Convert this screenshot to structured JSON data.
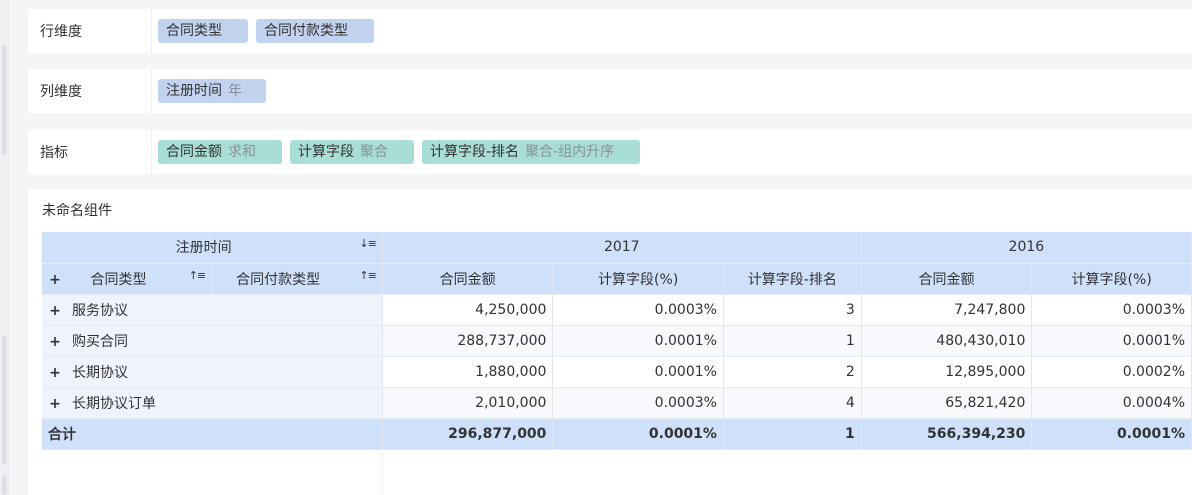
{
  "dims": [
    {
      "label": "行维度",
      "tags": [
        {
          "name": "合同类型",
          "sub": "",
          "kind": "dim"
        },
        {
          "name": "合同付款类型",
          "sub": "",
          "kind": "dim"
        }
      ]
    },
    {
      "label": "列维度",
      "tags": [
        {
          "name": "注册时间",
          "sub": "年",
          "kind": "dim"
        }
      ]
    },
    {
      "label": "指标",
      "tags": [
        {
          "name": "合同金额",
          "sub": "求和",
          "kind": "mea"
        },
        {
          "name": "计算字段",
          "sub": "聚合",
          "kind": "mea"
        },
        {
          "name": "计算字段-排名",
          "sub": "聚合-组内升序",
          "kind": "mea"
        }
      ]
    }
  ],
  "component": {
    "title": "未命名组件",
    "col_dim": "注册时间",
    "row_dims": [
      "合同类型",
      "合同付款类型"
    ],
    "years": [
      "2017",
      "2016"
    ],
    "measures": [
      "合同金额",
      "计算字段(%)",
      "计算字段-排名"
    ],
    "rows": [
      {
        "name": "服务协议",
        "v": [
          "4,250,000",
          "0.0003%",
          "3",
          "7,247,800",
          "0.0003%"
        ]
      },
      {
        "name": "购买合同",
        "v": [
          "288,737,000",
          "0.0001%",
          "1",
          "480,430,010",
          "0.0001%"
        ]
      },
      {
        "name": "长期协议",
        "v": [
          "1,880,000",
          "0.0001%",
          "2",
          "12,895,000",
          "0.0002%"
        ]
      },
      {
        "name": "长期协议订单",
        "v": [
          "2,010,000",
          "0.0003%",
          "4",
          "65,821,420",
          "0.0004%"
        ]
      }
    ],
    "total": {
      "name": "合计",
      "v": [
        "296,877,000",
        "0.0001%",
        "1",
        "566,394,230",
        "0.0001%"
      ]
    },
    "expand_glyph": "+",
    "sort_glyph": "↓≡",
    "sort_asc_glyph": "↑≡"
  }
}
